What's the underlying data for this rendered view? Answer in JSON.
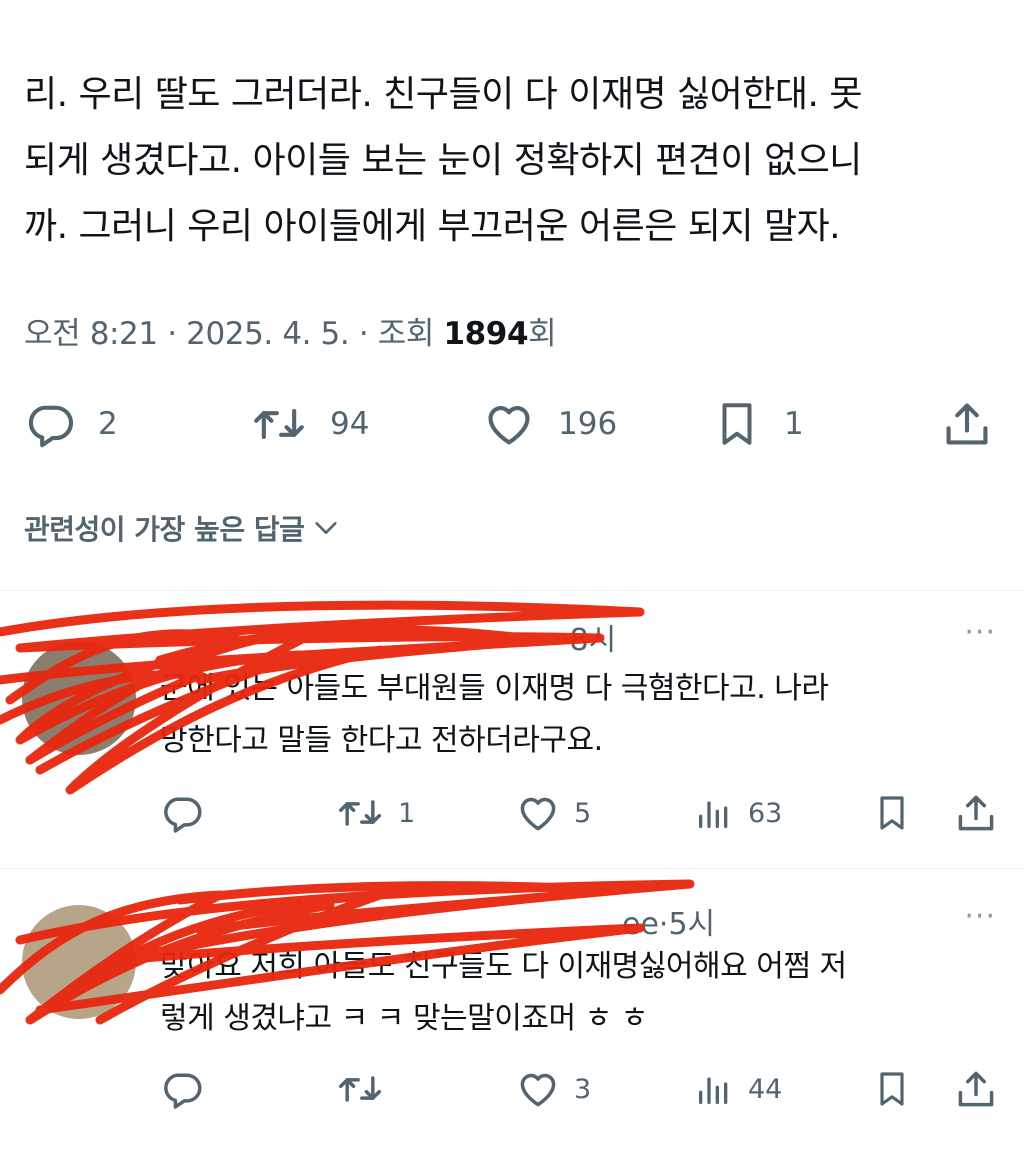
{
  "post": {
    "lines": [
      "리. 우리 딸도 그러더라. 친구들이 다 이재명 싫어한대. 못",
      "되게 생겼다고. 아이들 보는 눈이 정확하지 편견이 없으니",
      "까. 그러니 우리 아이들에게 부끄러운 어른은 되지 말자."
    ],
    "time": "오전 8:21",
    "date": "2025. 4. 5.",
    "views_label": "조회",
    "views": "1894",
    "views_suffix": "회",
    "sep": "·",
    "stats": {
      "replies": "2",
      "reposts": "94",
      "likes": "196",
      "bookmarks": "1"
    }
  },
  "sort": {
    "label": "관련성이 가장 높은 답글"
  },
  "replies": [
    {
      "time": "8시",
      "more": "···",
      "lines": [
        "군에  있는  아들도 부대원들  이재명 다 극혐한다고. 나라",
        "망한다고 말들 한다고 전하더라구요."
      ],
      "stats": {
        "replies": "",
        "reposts": "1",
        "likes": "5",
        "views": "63"
      }
    },
    {
      "name_tail": "ee",
      "time": "5시",
      "more": "···",
      "lines": [
        "맞아요 저희 아들도 친구들도 다 이재명싫어해요 어쩜 저",
        "렇게 생겼냐고 ㅋ ㅋ 맞는말이죠머 ㅎ ㅎ"
      ],
      "stats": {
        "replies": "",
        "reposts": "",
        "likes": "3",
        "views": "44"
      }
    }
  ],
  "colors": {
    "muted": "#536471",
    "text": "#0f1419",
    "divider": "#eff3f4",
    "scribble": "#e8260e"
  },
  "icons": [
    "reply-icon",
    "repost-icon",
    "like-icon",
    "bookmark-icon",
    "share-icon",
    "views-icon",
    "chevron-down-icon",
    "more-icon"
  ]
}
